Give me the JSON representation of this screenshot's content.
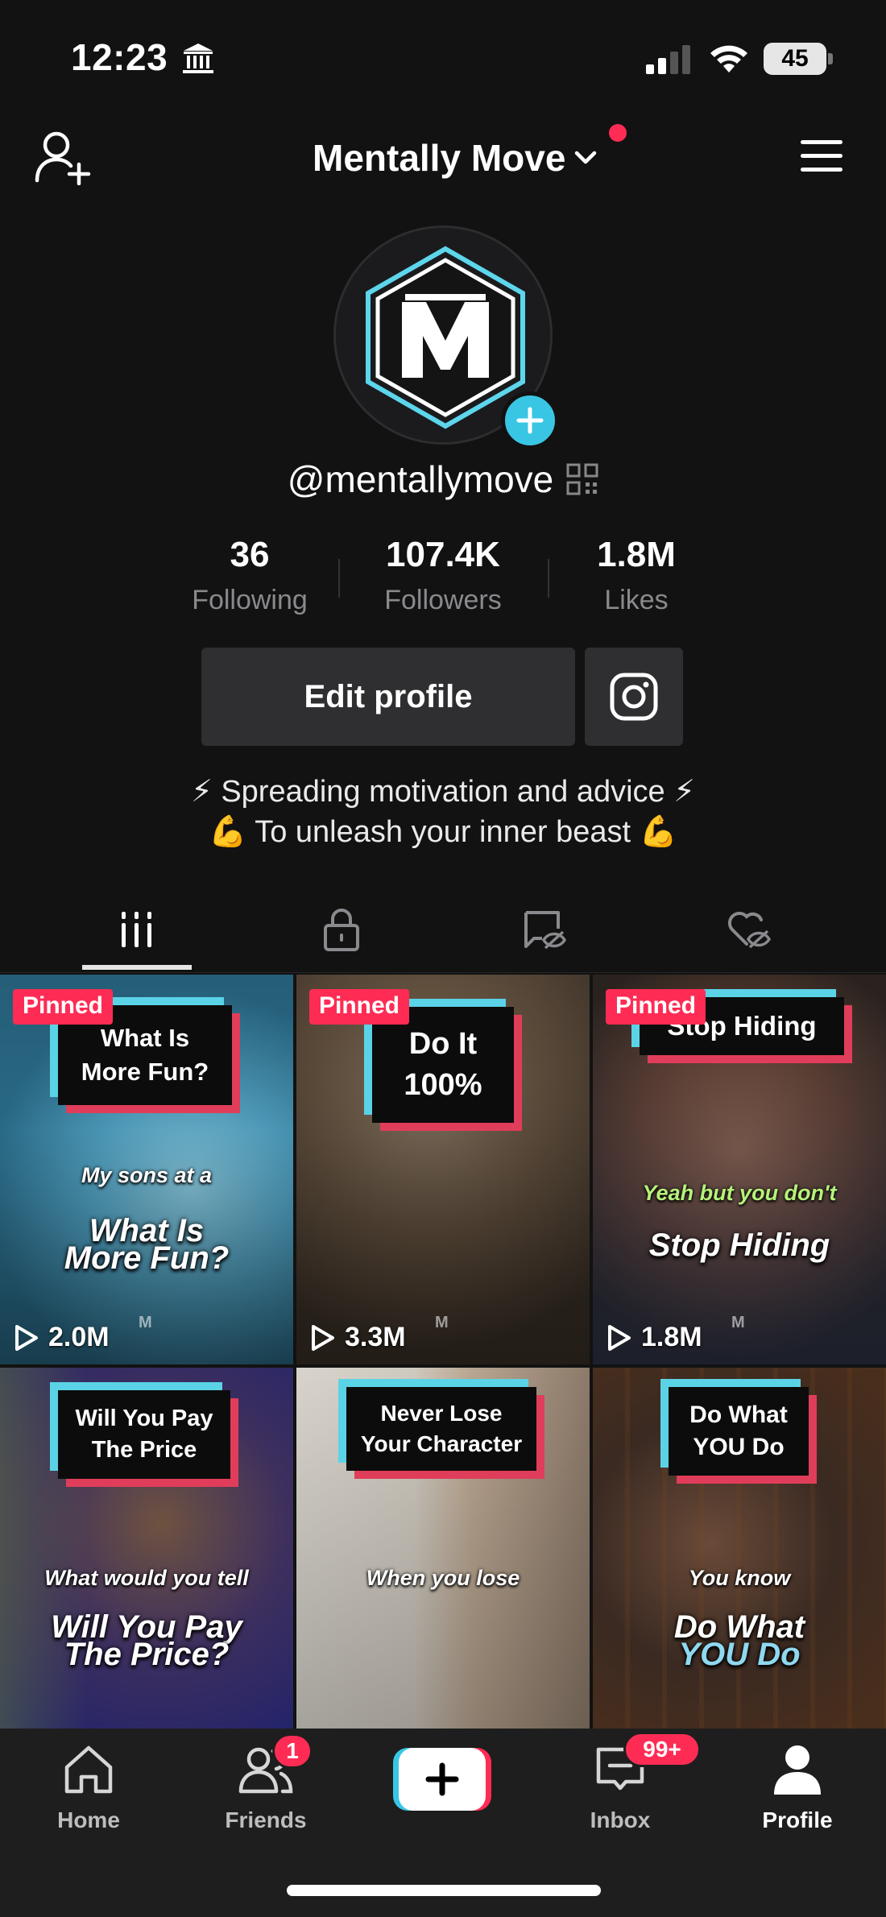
{
  "status_bar": {
    "time": "12:23",
    "battery": "45"
  },
  "header": {
    "account_name": "Mentally Move"
  },
  "profile": {
    "handle": "@mentallymove",
    "stats": [
      {
        "value": "36",
        "label": "Following"
      },
      {
        "value": "107.4K",
        "label": "Followers"
      },
      {
        "value": "1.8M",
        "label": "Likes"
      }
    ],
    "edit_label": "Edit profile",
    "bio_lines": [
      "⚡ Spreading motivation and advice ⚡",
      "💪 To unleash your inner beast 💪"
    ]
  },
  "videos": [
    {
      "pinned": "Pinned",
      "title_lines": [
        "What Is",
        "More Fun?"
      ],
      "caption1": "My sons at a",
      "caption2_a": "What Is",
      "caption2_b": "More Fun?",
      "views": "2.0M"
    },
    {
      "pinned": "Pinned",
      "title_lines": [
        "Do It",
        "100%"
      ],
      "views": "3.3M"
    },
    {
      "pinned": "Pinned",
      "title_lines": [
        "Stop Hiding"
      ],
      "caption1": "Yeah but you don't",
      "caption2_a": "Stop Hiding",
      "views": "1.8M"
    },
    {
      "title_lines": [
        "Will You Pay",
        "The Price"
      ],
      "caption1": "What would you tell",
      "caption2_a": "Will You Pay",
      "caption2_b": "The Price?"
    },
    {
      "title_lines": [
        "Never Lose",
        "Your Character"
      ],
      "caption1": "When you lose"
    },
    {
      "title_lines": [
        "Do What",
        "YOU Do"
      ],
      "caption1": "You know",
      "caption2_a": "Do What",
      "caption2_b": "YOU Do"
    }
  ],
  "nav": {
    "home": "Home",
    "friends": "Friends",
    "friends_badge": "1",
    "inbox": "Inbox",
    "inbox_badge": "99+",
    "profile": "Profile"
  },
  "colors": {
    "accent_red": "#fe2c55",
    "accent_cyan": "#39c6e5",
    "background": "#121212"
  },
  "icons": [
    "bank-icon",
    "signal-icon",
    "wifi-icon",
    "add-friend-icon",
    "chevron-down-icon",
    "hamburger-menu-icon",
    "qr-code-icon",
    "instagram-icon",
    "grid-icon",
    "lock-icon",
    "hidden-video-icon",
    "liked-hidden-icon",
    "play-icon",
    "home-icon",
    "friends-icon",
    "plus-icon",
    "inbox-icon",
    "profile-icon"
  ]
}
